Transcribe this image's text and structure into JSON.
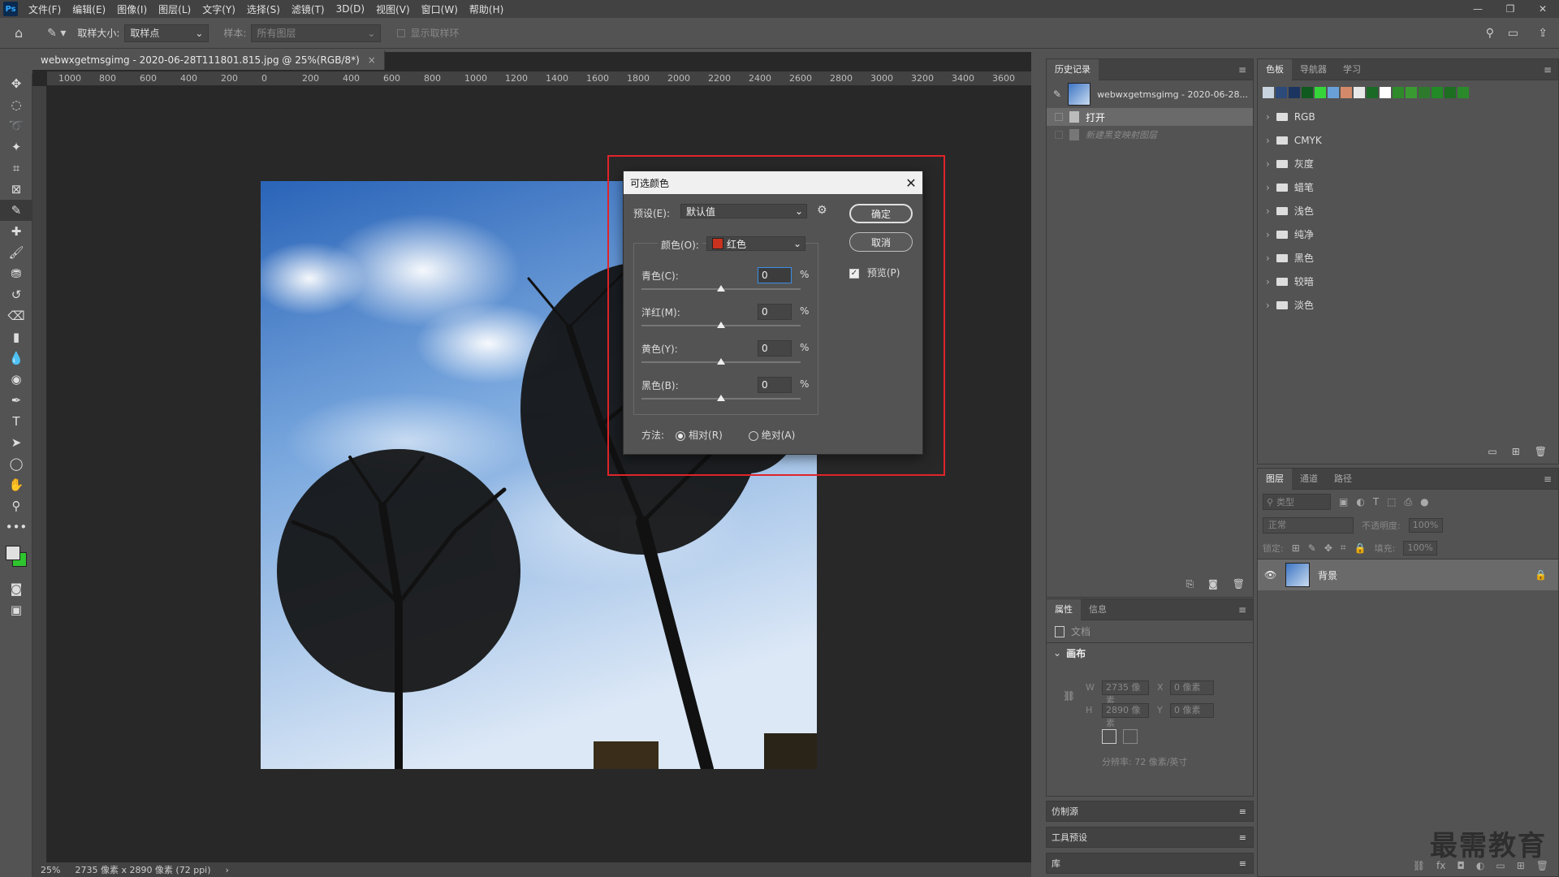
{
  "menubar": {
    "logo": "Ps",
    "items": [
      "文件(F)",
      "编辑(E)",
      "图像(I)",
      "图层(L)",
      "文字(Y)",
      "选择(S)",
      "滤镜(T)",
      "3D(D)",
      "视图(V)",
      "窗口(W)",
      "帮助(H)"
    ]
  },
  "options": {
    "sample_size_label": "取样大小:",
    "sample_size_value": "取样点",
    "sample_label": "样本:",
    "sample_value": "所有图层",
    "show_ring_label": "显示取样环"
  },
  "document": {
    "tab_title": "webwxgetmsgimg - 2020-06-28T111801.815.jpg @ 25%(RGB/8*)",
    "ruler_ticks": [
      "1000",
      "800",
      "600",
      "400",
      "200",
      "0",
      "200",
      "400",
      "600",
      "800",
      "1000",
      "1200",
      "1400",
      "1600",
      "1800",
      "2000",
      "2200",
      "2400",
      "2600",
      "2800",
      "3000",
      "3200",
      "3400",
      "3600"
    ],
    "zoom": "25%",
    "doc_size": "2735 像素 x 2890 像素 (72 ppi)"
  },
  "dialog": {
    "title": "可选颜色",
    "preset_label": "预设(E):",
    "preset_value": "默认值",
    "ok_label": "确定",
    "cancel_label": "取消",
    "preview_label": "预览(P)",
    "colors_label": "颜色(O):",
    "colors_value": "红色",
    "colors_swatch": "#c8321e",
    "sliders": [
      {
        "label": "青色(C):",
        "value": "0",
        "unit": "%"
      },
      {
        "label": "洋红(M):",
        "value": "0",
        "unit": "%"
      },
      {
        "label": "黄色(Y):",
        "value": "0",
        "unit": "%"
      },
      {
        "label": "黑色(B):",
        "value": "0",
        "unit": "%"
      }
    ],
    "method_label": "方法:",
    "method_relative": "相对(R)",
    "method_absolute": "绝对(A)"
  },
  "history": {
    "tab": "历史记录",
    "snapshot_label": "webwxgetmsgimg - 2020-06-28...",
    "items": [
      "打开",
      "新建黑变映射图层"
    ]
  },
  "swatches": {
    "tabs": [
      "色板",
      "导航器",
      "学习"
    ],
    "colors": [
      "#c8d4e0",
      "#2c4a7a",
      "#1c3560",
      "#0f5a1e",
      "#36d63a",
      "#6aa0d8",
      "#d48a6a",
      "#e8e8e8",
      "#1a6a26",
      "#ffffff",
      "#2e8a2a",
      "#3a9a32",
      "#2d7a2c",
      "#228a26",
      "#1e6e22",
      "#2a8a2a"
    ],
    "folders": [
      "RGB",
      "CMYK",
      "灰度",
      "蜡笔",
      "浅色",
      "纯净",
      "黑色",
      "较暗",
      "淡色"
    ]
  },
  "layers": {
    "tabs": [
      "图层",
      "通道",
      "路径"
    ],
    "search_placeholder": "类型",
    "blend_mode": "正常",
    "opacity_label": "不透明度:",
    "opacity_value": "100%",
    "lock_label": "锁定:",
    "fill_label": "填充:",
    "fill_value": "100%",
    "layer_name": "背景"
  },
  "properties": {
    "tabs": [
      "属性",
      "信息"
    ],
    "doc_label": "文档",
    "canvas_label": "画布",
    "w_label": "W",
    "w_value": "2735 像素",
    "h_label": "H",
    "h_value": "2890 像素",
    "x_label": "X",
    "x_value": "0 像素",
    "y_label": "Y",
    "y_value": "0 像素",
    "resolution": "分辨率: 72 像素/英寸"
  },
  "collapsed_panels": [
    "仿制源",
    "工具预设",
    "库"
  ],
  "watermark": "最需教育"
}
